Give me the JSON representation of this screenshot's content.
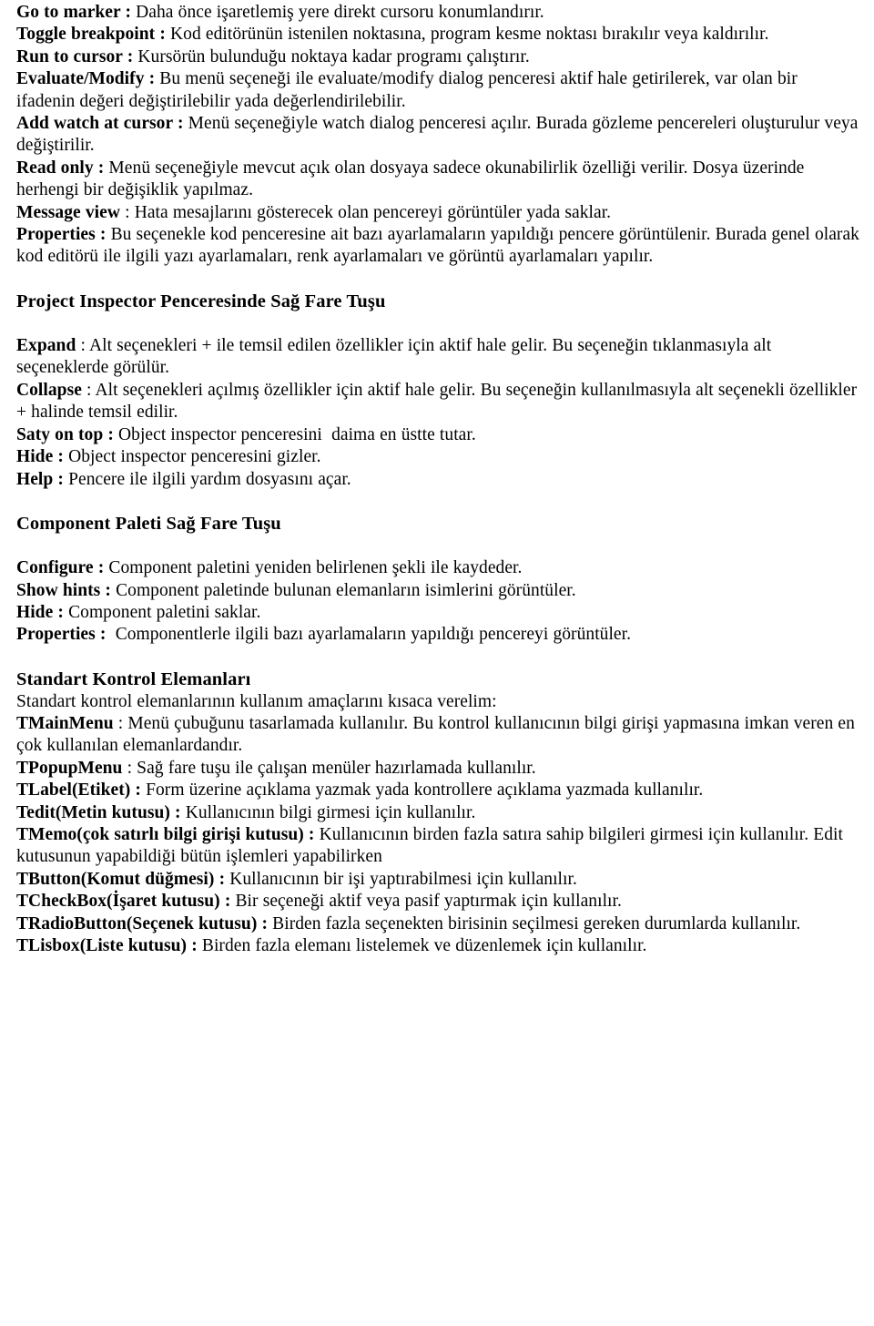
{
  "document": {
    "language": "tr",
    "sections": [
      {
        "id": "code-editor-menu",
        "entries": [
          {
            "term": "Go to marker :",
            "text": " Daha önce işaretlemiş yere direkt cursoru konumlandırır."
          },
          {
            "term": "Toggle breakpoint :",
            "text": " Kod editörünün istenilen noktasına, program kesme noktası bırakılır veya kaldırılır."
          },
          {
            "term": "Run to cursor :",
            "text": " Kursörün bulunduğu noktaya kadar programı çalıştırır."
          },
          {
            "term": "Evaluate/Modify :",
            "text": " Bu menü seçeneği ile evaluate/modify dialog penceresi aktif hale getirilerek, var olan bir ifadenin değeri değiştirilebilir yada değerlendirilebilir."
          },
          {
            "term": "Add watch at cursor :",
            "text": " Menü seçeneğiyle watch dialog penceresi açılır. Burada gözleme pencereleri oluşturulur veya değiştirilir."
          },
          {
            "term": "Read only :",
            "text": " Menü seçeneğiyle mevcut açık olan dosyaya sadece okunabilirlik özelliği verilir. Dosya üzerinde herhengi bir değişiklik yapılmaz."
          },
          {
            "term": "Message view",
            "text": " : Hata mesajlarını gösterecek olan pencereyi görüntüler yada saklar."
          },
          {
            "term": "Properties :",
            "text": " Bu seçenekle kod penceresine ait bazı ayarlamaların yapıldığı pencere görüntülenir. Burada genel olarak kod editörü ile ilgili yazı ayarlamaları, renk ayarlamaları ve görüntü ayarlamaları yapılır."
          }
        ]
      },
      {
        "id": "project-inspector",
        "heading": "Project Inspector Penceresinde Sağ Fare Tuşu",
        "entries": [
          {
            "term": "Expand",
            "text": " : Alt seçenekleri + ile temsil edilen özellikler için aktif hale gelir. Bu seçeneğin tıklanmasıyla alt seçeneklerde görülür."
          },
          {
            "term": "Collapse",
            "text": " : Alt seçenekleri açılmış özellikler için aktif hale gelir. Bu seçeneğin kullanılmasıyla alt seçenekli özellikler + halinde temsil edilir."
          },
          {
            "term": "Saty on top :",
            "text": " Object inspector penceresini  daima en üstte tutar."
          },
          {
            "term": "Hide :",
            "text": " Object inspector penceresini gizler."
          },
          {
            "term": "Help :",
            "text": " Pencere ile ilgili yardım dosyasını açar."
          }
        ]
      },
      {
        "id": "component-palette",
        "heading": "Component Paleti Sağ Fare Tuşu",
        "entries": [
          {
            "term": "Configure :",
            "text": " Component paletini yeniden belirlenen şekli ile kaydeder."
          },
          {
            "term": "Show hints :",
            "text": " Component paletinde bulunan elemanların isimlerini görüntüler."
          },
          {
            "term": "Hide :",
            "text": " Component paletini saklar."
          },
          {
            "term": "Properties :",
            "text": "  Componentlerle ilgili bazı ayarlamaların yapıldığı pencereyi görüntüler."
          }
        ]
      },
      {
        "id": "standard-controls",
        "heading": "Standart Kontrol Elemanları",
        "intro": "Standart kontrol elemanlarının kullanım amaçlarını kısaca verelim:",
        "entries": [
          {
            "term": "TMainMenu",
            "text": " : Menü çubuğunu tasarlamada kullanılır. Bu kontrol kullanıcının bilgi girişi yapmasına imkan veren en çok kullanılan elemanlardandır."
          },
          {
            "term": "TPopupMenu",
            "text": " : Sağ fare tuşu ile çalışan menüler hazırlamada kullanılır."
          },
          {
            "term": "TLabel(Etiket) :",
            "text": " Form üzerine açıklama yazmak yada kontrollere açıklama yazmada kullanılır."
          },
          {
            "term": "Tedit(Metin kutusu) :",
            "text": " Kullanıcının bilgi girmesi için kullanılır."
          },
          {
            "term": "TMemo(çok satırlı bilgi girişi kutusu) :",
            "text": " Kullanıcının birden fazla satıra sahip bilgileri girmesi için kullanılır. Edit kutusunun yapabildiği bütün işlemleri yapabilirken"
          },
          {
            "term": "TButton(Komut düğmesi) :",
            "text": " Kullanıcının bir işi yaptırabilmesi için kullanılır."
          },
          {
            "term": "TCheckBox(İşaret kutusu) :",
            "text": " Bir seçeneği aktif veya pasif yaptırmak için kullanılır."
          },
          {
            "term": "TRadioButton(Seçenek kutusu) :",
            "text": " Birden fazla seçenekten birisinin seçilmesi gereken durumlarda kullanılır."
          },
          {
            "term": "TLisbox(Liste kutusu) :",
            "text": " Birden fazla elemanı listelemek ve düzenlemek için kullanılır."
          }
        ]
      }
    ]
  }
}
